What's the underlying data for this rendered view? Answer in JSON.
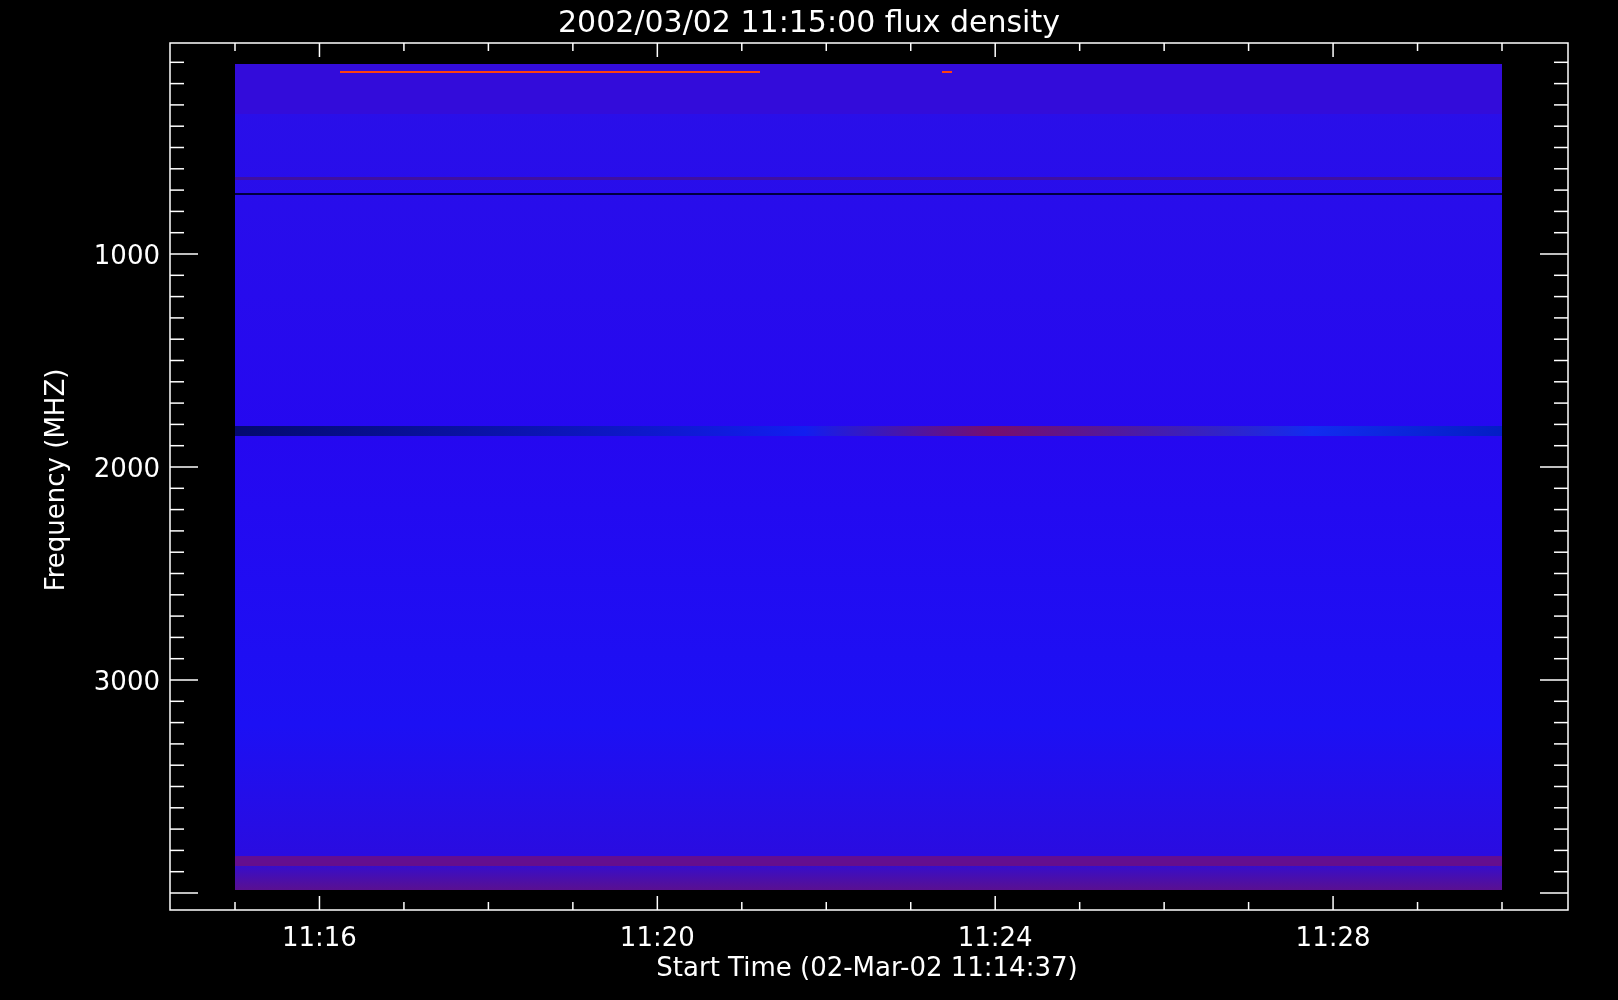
{
  "title": "2002/03/02 11:15:00 flux density",
  "x_axis": {
    "label": "Start Time (02-Mar-02 11:14:37)",
    "tick_labels": [
      "11:16",
      "11:20",
      "11:24",
      "11:28"
    ]
  },
  "y_axis": {
    "label": "Frequency (MHZ)",
    "tick_labels": [
      "1000",
      "2000",
      "3000"
    ]
  }
}
